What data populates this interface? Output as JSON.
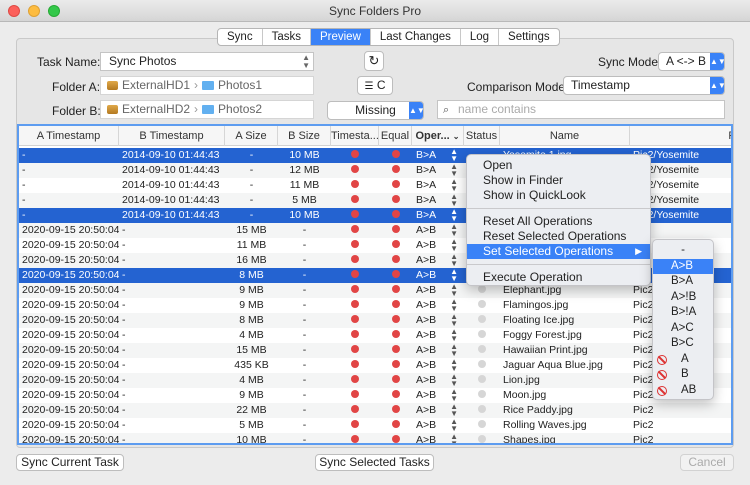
{
  "window": {
    "title": "Sync Folders Pro"
  },
  "tabs": [
    "Sync",
    "Tasks",
    "Preview",
    "Last Changes",
    "Log",
    "Settings"
  ],
  "active_tab": "Preview",
  "task": {
    "label": "Task Name:",
    "value": "Sync Photos"
  },
  "sync_mode": {
    "label": "Sync Mode:",
    "value": "A <-> B"
  },
  "folder_a": {
    "label": "Folder A:",
    "drive": "ExternalHD1",
    "folder": "Photos1"
  },
  "folder_b": {
    "label": "Folder B:",
    "drive": "ExternalHD2",
    "folder": "Photos2"
  },
  "compare_button": {
    "label": "C"
  },
  "comparison_mode": {
    "label": "Comparison Mode:",
    "value": "Timestamp"
  },
  "filter": {
    "value": "Missing"
  },
  "search": {
    "placeholder": "name contains"
  },
  "table": {
    "columns": [
      "A Timestamp",
      "B Timestamp",
      "A Size",
      "B Size",
      "Timesta...",
      "Equal",
      "Oper...",
      "Status",
      "Name",
      "Path"
    ],
    "rows": [
      {
        "a_ts": "-",
        "b_ts": "2014-09-10 01:44:43",
        "a_size": "-",
        "b_size": "10 MB",
        "op": "B>A",
        "status": "",
        "name": "Yosemite 1.jpg",
        "path": "Pic2/Yosemite",
        "selected": true
      },
      {
        "a_ts": "-",
        "b_ts": "2014-09-10 01:44:43",
        "a_size": "-",
        "b_size": "12 MB",
        "op": "B>A",
        "status": "",
        "name": "",
        "path": "Pic2/Yosemite",
        "selected": false
      },
      {
        "a_ts": "-",
        "b_ts": "2014-09-10 01:44:43",
        "a_size": "-",
        "b_size": "11 MB",
        "op": "B>A",
        "status": "",
        "name": "",
        "path": "Pic2/Yosemite",
        "selected": false
      },
      {
        "a_ts": "-",
        "b_ts": "2014-09-10 01:44:43",
        "a_size": "-",
        "b_size": "5 MB",
        "op": "B>A",
        "status": "",
        "name": "",
        "path": "Pic2/Yosemite",
        "selected": false
      },
      {
        "a_ts": "-",
        "b_ts": "2014-09-10 01:44:43",
        "a_size": "-",
        "b_size": "10 MB",
        "op": "B>A",
        "status": "",
        "name": "",
        "path": "Pic2/Yosemite",
        "selected": true
      },
      {
        "a_ts": "2020-09-15 20:50:04",
        "b_ts": "-",
        "a_size": "15 MB",
        "b_size": "-",
        "op": "A>B",
        "status": "",
        "name": "",
        "path": "",
        "selected": false
      },
      {
        "a_ts": "2020-09-15 20:50:04",
        "b_ts": "-",
        "a_size": "11 MB",
        "b_size": "-",
        "op": "A>B",
        "status": "",
        "name": "",
        "path": "",
        "selected": false
      },
      {
        "a_ts": "2020-09-15 20:50:04",
        "b_ts": "-",
        "a_size": "16 MB",
        "b_size": "-",
        "op": "A>B",
        "status": "",
        "name": "",
        "path": "",
        "selected": false
      },
      {
        "a_ts": "2020-09-15 20:50:04",
        "b_ts": "-",
        "a_size": "8 MB",
        "b_size": "-",
        "op": "A>B",
        "status": "",
        "name": "",
        "path": "",
        "selected": true
      },
      {
        "a_ts": "2020-09-15 20:50:04",
        "b_ts": "-",
        "a_size": "9 MB",
        "b_size": "-",
        "op": "A>B",
        "status": "grey",
        "name": "Elephant.jpg",
        "path": "Pic2",
        "selected": false
      },
      {
        "a_ts": "2020-09-15 20:50:04",
        "b_ts": "-",
        "a_size": "9 MB",
        "b_size": "-",
        "op": "A>B",
        "status": "grey",
        "name": "Flamingos.jpg",
        "path": "Pic2",
        "selected": false
      },
      {
        "a_ts": "2020-09-15 20:50:04",
        "b_ts": "-",
        "a_size": "8 MB",
        "b_size": "-",
        "op": "A>B",
        "status": "grey",
        "name": "Floating Ice.jpg",
        "path": "Pic2",
        "selected": false
      },
      {
        "a_ts": "2020-09-15 20:50:04",
        "b_ts": "-",
        "a_size": "4 MB",
        "b_size": "-",
        "op": "A>B",
        "status": "grey",
        "name": "Foggy Forest.jpg",
        "path": "Pic2",
        "selected": false
      },
      {
        "a_ts": "2020-09-15 20:50:04",
        "b_ts": "-",
        "a_size": "15 MB",
        "b_size": "-",
        "op": "A>B",
        "status": "grey",
        "name": "Hawaiian Print.jpg",
        "path": "Pic2",
        "selected": false
      },
      {
        "a_ts": "2020-09-15 20:50:04",
        "b_ts": "-",
        "a_size": "435 KB",
        "b_size": "-",
        "op": "A>B",
        "status": "grey",
        "name": "Jaguar Aqua Blue.jpg",
        "path": "Pic2",
        "selected": false
      },
      {
        "a_ts": "2020-09-15 20:50:04",
        "b_ts": "-",
        "a_size": "4 MB",
        "b_size": "-",
        "op": "A>B",
        "status": "grey",
        "name": "Lion.jpg",
        "path": "Pic2",
        "selected": false
      },
      {
        "a_ts": "2020-09-15 20:50:04",
        "b_ts": "-",
        "a_size": "9 MB",
        "b_size": "-",
        "op": "A>B",
        "status": "grey",
        "name": "Moon.jpg",
        "path": "Pic2",
        "selected": false
      },
      {
        "a_ts": "2020-09-15 20:50:04",
        "b_ts": "-",
        "a_size": "22 MB",
        "b_size": "-",
        "op": "A>B",
        "status": "grey",
        "name": "Rice Paddy.jpg",
        "path": "Pic2",
        "selected": false
      },
      {
        "a_ts": "2020-09-15 20:50:04",
        "b_ts": "-",
        "a_size": "5 MB",
        "b_size": "-",
        "op": "A>B",
        "status": "grey",
        "name": "Rolling Waves.jpg",
        "path": "Pic2",
        "selected": false
      },
      {
        "a_ts": "2020-09-15 20:50:04",
        "b_ts": "-",
        "a_size": "10 MB",
        "b_size": "-",
        "op": "A>B",
        "status": "grey",
        "name": "Shapes.jpg",
        "path": "Pic2",
        "selected": false
      }
    ]
  },
  "context_menu": {
    "items": [
      "Open",
      "Show in Finder",
      "Show in QuickLook",
      "Reset All Operations",
      "Reset Selected Operations",
      "Set Selected Operations",
      "Execute Operation"
    ],
    "highlighted": "Set Selected Operations"
  },
  "submenu": {
    "items": [
      {
        "label": "-",
        "icon": ""
      },
      {
        "label": "A>B",
        "icon": ""
      },
      {
        "label": "B>A",
        "icon": ""
      },
      {
        "label": "A>!B",
        "icon": ""
      },
      {
        "label": "B>!A",
        "icon": ""
      },
      {
        "label": "A>C",
        "icon": ""
      },
      {
        "label": "B>C",
        "icon": ""
      },
      {
        "label": "A",
        "icon": "no-entry-icon"
      },
      {
        "label": "B",
        "icon": "no-entry-icon"
      },
      {
        "label": "AB",
        "icon": "no-entry-icon"
      }
    ],
    "highlighted": "A>B"
  },
  "footer": {
    "sync_current": "Sync Current Task",
    "sync_selected": "Sync Selected Tasks",
    "cancel": "Cancel"
  },
  "colors": {
    "accent": "#3a82f7",
    "selection": "#2463d1",
    "error_dot": "#e14545"
  }
}
